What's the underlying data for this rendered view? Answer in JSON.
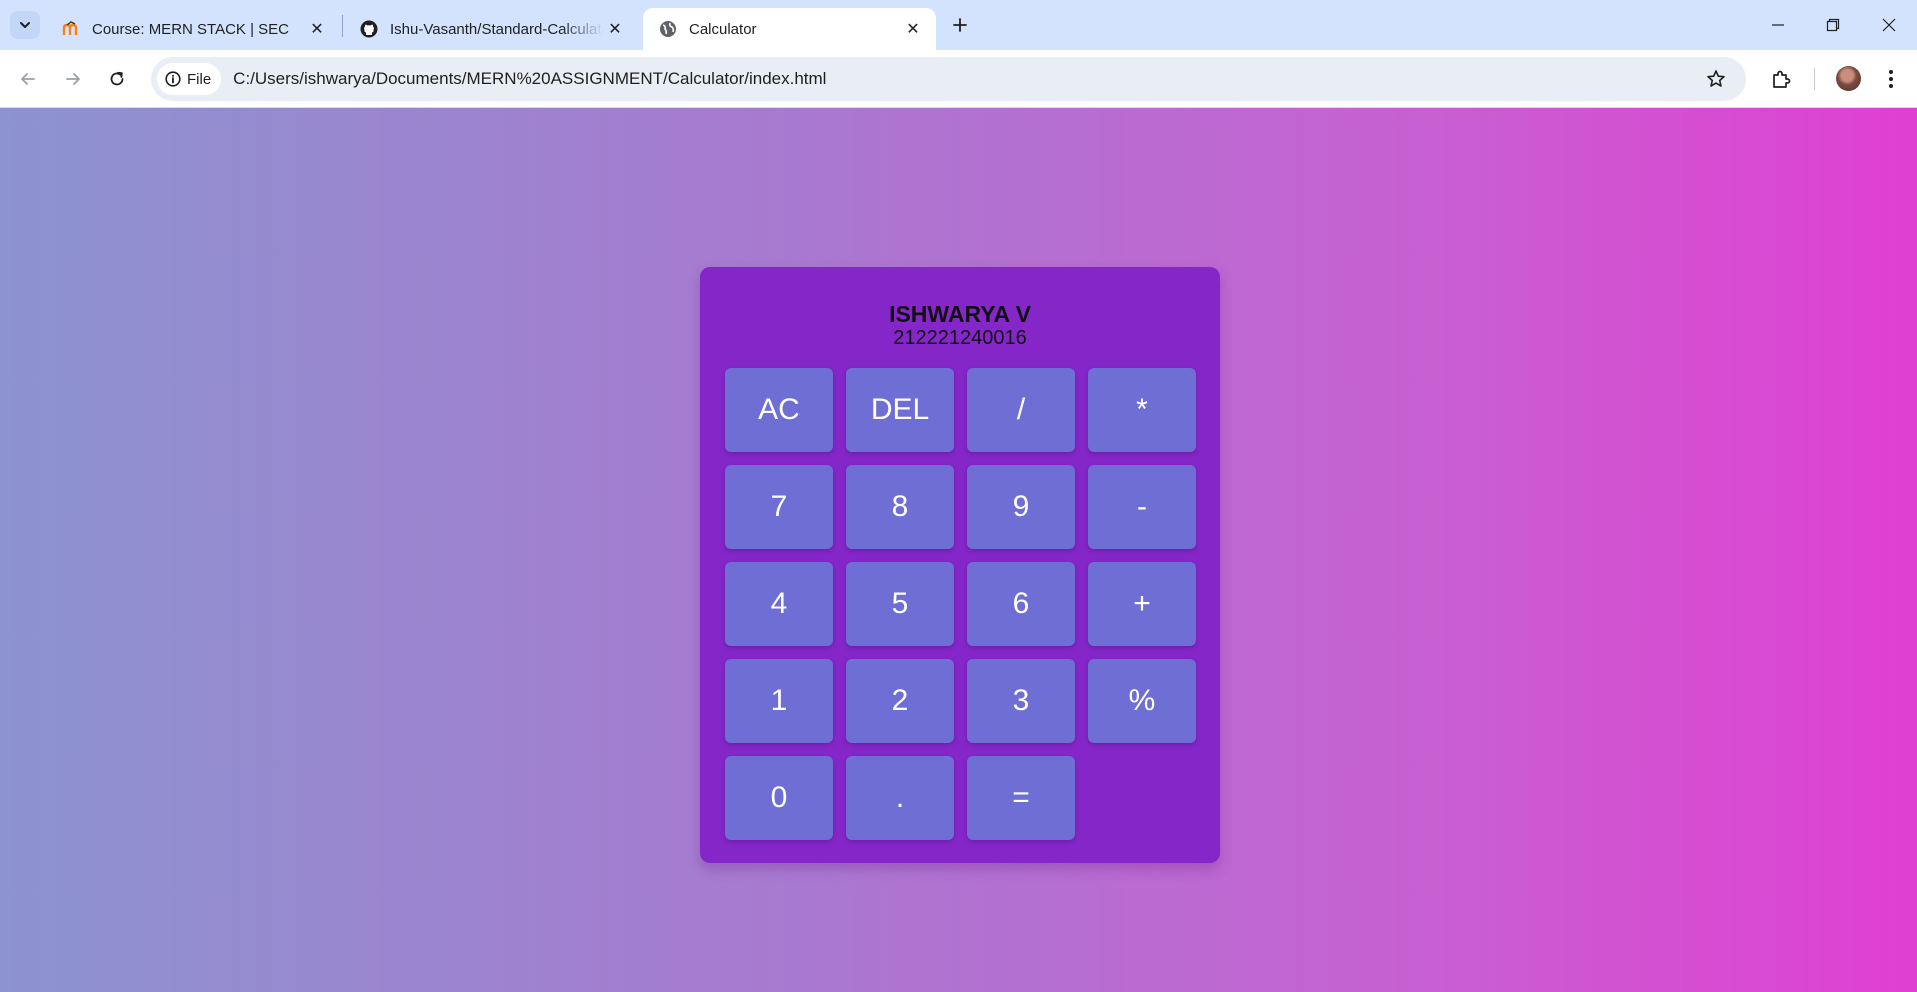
{
  "browser": {
    "tabs": [
      {
        "title": "Course: MERN STACK | SEC",
        "favicon": "moodle-icon",
        "active": false
      },
      {
        "title": "Ishu-Vasanth/Standard-Calculator",
        "favicon": "github-icon",
        "active": false
      },
      {
        "title": "Calculator",
        "favicon": "globe-icon",
        "active": true
      }
    ],
    "address": {
      "chip_label": "File",
      "url": "C:/Users/ishwarya/Documents/MERN%20ASSIGNMENT/Calculator/index.html"
    }
  },
  "page": {
    "background_gradient": [
      "#8c93cf",
      "#e03fd2"
    ],
    "calculator": {
      "name": "ISHWARYA V",
      "id_number": "212221240016",
      "panel_color": "#8526c9",
      "key_color": "#6f6ed5",
      "keys": [
        "AC",
        "DEL",
        "/",
        "*",
        "7",
        "8",
        "9",
        "-",
        "4",
        "5",
        "6",
        "+",
        "1",
        "2",
        "3",
        "%",
        "0",
        ".",
        "="
      ]
    }
  }
}
